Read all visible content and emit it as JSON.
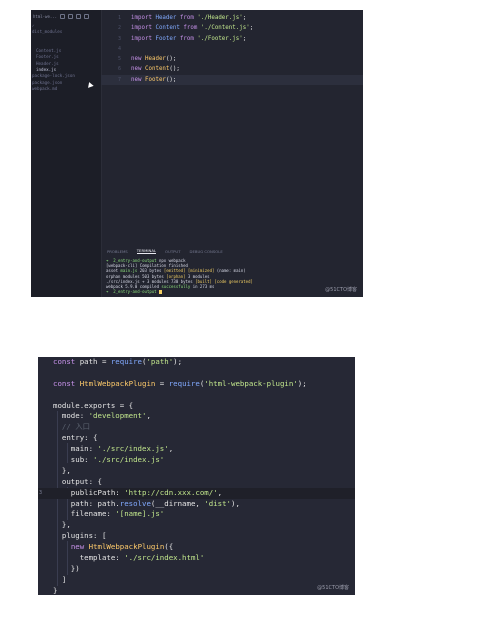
{
  "shot1": {
    "sidebar": {
      "header_title": "html-we...",
      "tree": [
        {
          "label": "✓",
          "selected": false
        },
        {
          "label": "dist_modules",
          "selected": false
        },
        {
          "label": "",
          "selected": false
        },
        {
          "label": "",
          "selected": false
        },
        {
          "label": "Content.js",
          "selected": false
        },
        {
          "label": "Footer.js",
          "selected": false
        },
        {
          "label": "Header.js",
          "selected": false
        },
        {
          "label": "index.js",
          "selected": true
        },
        {
          "label": "package-lock.json",
          "selected": false
        },
        {
          "label": "package.json",
          "selected": false
        },
        {
          "label": "webpack.md",
          "selected": false
        }
      ]
    },
    "editor_lines": [
      {
        "n": "1",
        "parts": [
          [
            "kw",
            "import"
          ],
          [
            "pl",
            " "
          ],
          [
            "id",
            "Header"
          ],
          [
            "pl",
            " "
          ],
          [
            "kw",
            "from"
          ],
          [
            "pl",
            " "
          ],
          [
            "str",
            "'./Header.js'"
          ],
          [
            "pl",
            ";"
          ]
        ]
      },
      {
        "n": "2",
        "parts": [
          [
            "kw",
            "import"
          ],
          [
            "pl",
            " "
          ],
          [
            "id",
            "Content"
          ],
          [
            "pl",
            " "
          ],
          [
            "kw",
            "from"
          ],
          [
            "pl",
            " "
          ],
          [
            "str",
            "'./Content.js'"
          ],
          [
            "pl",
            ";"
          ]
        ]
      },
      {
        "n": "3",
        "parts": [
          [
            "kw",
            "import"
          ],
          [
            "pl",
            " "
          ],
          [
            "id",
            "Footer"
          ],
          [
            "pl",
            " "
          ],
          [
            "kw",
            "from"
          ],
          [
            "pl",
            " "
          ],
          [
            "str",
            "'./Footer.js'"
          ],
          [
            "pl",
            ";"
          ]
        ]
      },
      {
        "n": "4",
        "parts": []
      },
      {
        "n": "5",
        "parts": [
          [
            "kw",
            "new"
          ],
          [
            "pl",
            " "
          ],
          [
            "fn",
            "Header"
          ],
          [
            "pl",
            "();"
          ]
        ]
      },
      {
        "n": "6",
        "parts": [
          [
            "kw",
            "new"
          ],
          [
            "pl",
            " "
          ],
          [
            "fn",
            "Content"
          ],
          [
            "pl",
            "();"
          ]
        ]
      },
      {
        "n": "7",
        "parts": [
          [
            "kw",
            "new"
          ],
          [
            "pl",
            " "
          ],
          [
            "fn",
            "Footer"
          ],
          [
            "pl",
            "();"
          ]
        ],
        "highlight": true
      }
    ],
    "panel_tabs": [
      "PROBLEMS",
      "TERMINAL",
      "OUTPUT",
      "DEBUG CONSOLE"
    ],
    "active_tab": "TERMINAL",
    "terminal_lines": [
      [
        [
          "g",
          "➜  2_entry-and-output"
        ],
        [
          "",
          " npx webpack"
        ]
      ],
      [
        [
          "",
          "[webpack-cli] Compilation finished"
        ]
      ],
      [
        [
          "",
          "asset "
        ],
        [
          "g",
          "main.js"
        ],
        [
          "",
          " 203 bytes "
        ],
        [
          "y",
          "[emitted] [minimized]"
        ],
        [
          "",
          " (name: main)"
        ]
      ],
      [
        [
          "",
          "orphan modules 503 bytes "
        ],
        [
          "y",
          "[orphan]"
        ],
        [
          "",
          " 3 modules"
        ]
      ],
      [
        [
          "",
          "./src/index.js + 3 modules 730 bytes "
        ],
        [
          "y",
          "[built] [code generated]"
        ]
      ],
      [
        [
          "",
          "webpack 5.9.0 compiled "
        ],
        [
          "g",
          "successfully"
        ],
        [
          "",
          " in 273 ms"
        ]
      ],
      [
        [
          "g",
          "➜  2_entry-and-output"
        ],
        [
          "",
          " "
        ]
      ]
    ],
    "watermark": "@51CTO博客"
  },
  "shot2": {
    "lines": [
      [
        [
          "kw",
          "const"
        ],
        [
          "pl",
          " path = "
        ],
        [
          "id",
          "require"
        ],
        [
          "pl",
          "("
        ],
        [
          "str",
          "'path'"
        ],
        [
          "pl",
          ");"
        ]
      ],
      [],
      [
        [
          "kw",
          "const"
        ],
        [
          "pl",
          " "
        ],
        [
          "fn",
          "HtmlWebpackPlugin"
        ],
        [
          "pl",
          " = "
        ],
        [
          "id",
          "require"
        ],
        [
          "pl",
          "("
        ],
        [
          "str",
          "'html-webpack-plugin'"
        ],
        [
          "pl",
          ");"
        ]
      ],
      [],
      [
        [
          "pl",
          "module.exports = {"
        ]
      ],
      [
        [
          "pl",
          "  mode: "
        ],
        [
          "str",
          "'development'"
        ],
        [
          "pl",
          ","
        ]
      ],
      [
        [
          "cm",
          "  // 入口"
        ]
      ],
      [
        [
          "pl",
          "  entry: {"
        ]
      ],
      [
        [
          "pl",
          "    main: "
        ],
        [
          "str",
          "'./src/index.js'"
        ],
        [
          "pl",
          ","
        ]
      ],
      [
        [
          "pl",
          "    sub: "
        ],
        [
          "str",
          "'./src/index.js'"
        ]
      ],
      [
        [
          "pl",
          "  },"
        ]
      ],
      [
        [
          "pl",
          "  output: {"
        ]
      ],
      [
        [
          "pl",
          "    publicPath: "
        ],
        [
          "str",
          "'http://cdn.xxx.com/'"
        ],
        [
          "pl",
          ","
        ]
      ],
      [
        [
          "pl",
          "    path: path."
        ],
        [
          "id",
          "resolve"
        ],
        [
          "pl",
          "(__dirname, "
        ],
        [
          "str",
          "'dist'"
        ],
        [
          "pl",
          "),"
        ]
      ],
      [
        [
          "pl",
          "    filename: "
        ],
        [
          "str",
          "'[name].js'"
        ]
      ],
      [
        [
          "pl",
          "  },"
        ]
      ],
      [
        [
          "pl",
          "  plugins: ["
        ]
      ],
      [
        [
          "pl",
          "    "
        ],
        [
          "kw",
          "new"
        ],
        [
          "pl",
          " "
        ],
        [
          "fn",
          "HtmlWebpackPlugin"
        ],
        [
          "pl",
          "({"
        ]
      ],
      [
        [
          "pl",
          "      template: "
        ],
        [
          "str",
          "'./src/index.html'"
        ]
      ],
      [
        [
          "pl",
          "    })"
        ]
      ],
      [
        [
          "pl",
          "  ]"
        ]
      ],
      [
        [
          "pl",
          "}"
        ]
      ]
    ],
    "highlight_line": 12,
    "gutter_mark": "3",
    "watermark": "@51CTO博客"
  }
}
